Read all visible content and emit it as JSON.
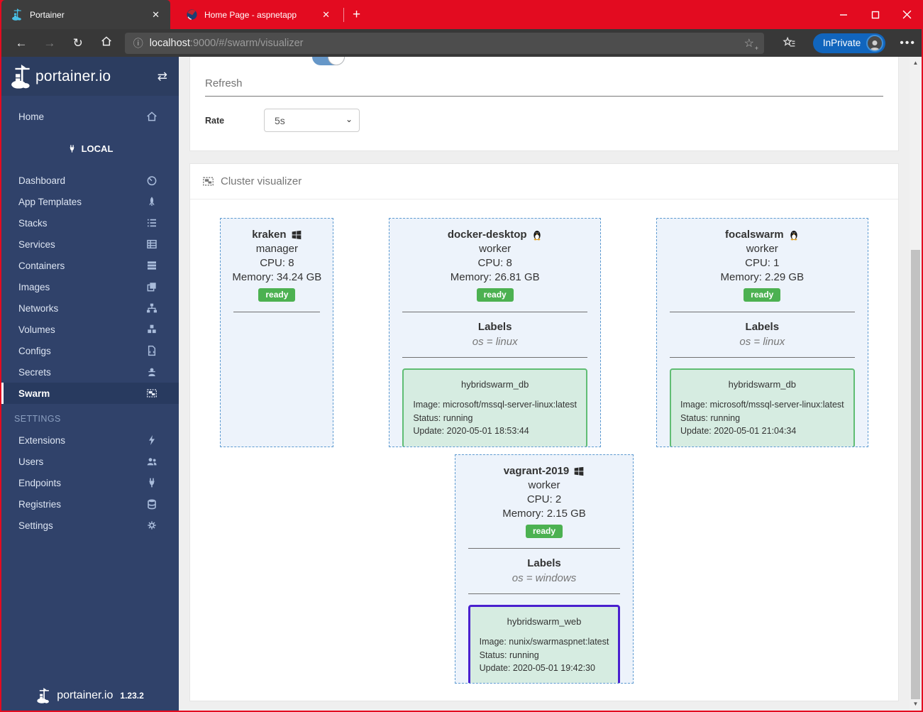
{
  "colors": {
    "frame_red": "#e30b20",
    "sidebar_blue": "#30426a",
    "ready_green": "#4cb151",
    "task_border_green": "#60bd74",
    "task_selected_purple": "#4a20cf",
    "node_border_blue": "#5e9bd1",
    "inprivate_blue": "#1165bd"
  },
  "browser": {
    "tabs": [
      {
        "title": "Portainer",
        "favicon": "portainer-whale-icon"
      },
      {
        "title": "Home Page - aspnetapp",
        "favicon": "aspnetcore-icon"
      }
    ],
    "address": {
      "host": "localhost",
      "path": ":9000/#/swarm/visualizer"
    },
    "inprivate_label": "InPrivate"
  },
  "sidebar": {
    "brand": "portainer.io",
    "home": {
      "label": "Home",
      "icon": "home-icon"
    },
    "endpoint_header": {
      "label": "LOCAL",
      "icon": "plug-icon"
    },
    "items": [
      {
        "label": "Dashboard",
        "icon": "tachometer-icon"
      },
      {
        "label": "App Templates",
        "icon": "rocket-icon"
      },
      {
        "label": "Stacks",
        "icon": "list-icon"
      },
      {
        "label": "Services",
        "icon": "th-list-icon"
      },
      {
        "label": "Containers",
        "icon": "server-icon"
      },
      {
        "label": "Images",
        "icon": "clone-icon"
      },
      {
        "label": "Networks",
        "icon": "sitemap-icon"
      },
      {
        "label": "Volumes",
        "icon": "cubes-icon"
      },
      {
        "label": "Configs",
        "icon": "file-icon"
      },
      {
        "label": "Secrets",
        "icon": "user-secret-icon"
      },
      {
        "label": "Swarm",
        "icon": "object-group-icon"
      }
    ],
    "settings_header": "SETTINGS",
    "settings_items": [
      {
        "label": "Extensions",
        "icon": "bolt-icon"
      },
      {
        "label": "Users",
        "icon": "users-icon"
      },
      {
        "label": "Endpoints",
        "icon": "plug-icon"
      },
      {
        "label": "Registries",
        "icon": "database-icon"
      },
      {
        "label": "Settings",
        "icon": "cogs-icon"
      }
    ],
    "footer": {
      "brand": "portainer.io",
      "version": "1.23.2"
    }
  },
  "main": {
    "refresh": {
      "title": "Refresh",
      "rate_label": "Rate",
      "rate_value": "5s"
    },
    "visualizer": {
      "title": "Cluster visualizer",
      "nodes": [
        {
          "name": "kraken",
          "os": "windows",
          "role": "manager",
          "cpu": "CPU: 8",
          "memory": "Memory: 34.24 GB",
          "status": "ready"
        },
        {
          "name": "docker-desktop",
          "os": "linux",
          "role": "worker",
          "cpu": "CPU: 8",
          "memory": "Memory: 26.81 GB",
          "status": "ready",
          "labels_title": "Labels",
          "labels": "os = linux",
          "task": {
            "name": "hybridswarm_db",
            "image": "Image: microsoft/mssql-server-linux:latest",
            "status": "Status: running",
            "update": "Update: 2020-05-01 18:53:44"
          }
        },
        {
          "name": "focalswarm",
          "os": "linux",
          "role": "worker",
          "cpu": "CPU: 1",
          "memory": "Memory: 2.29 GB",
          "status": "ready",
          "labels_title": "Labels",
          "labels": "os = linux",
          "task": {
            "name": "hybridswarm_db",
            "image": "Image: microsoft/mssql-server-linux:latest",
            "status": "Status: running",
            "update": "Update: 2020-05-01 21:04:34"
          }
        },
        {
          "name": "vagrant-2019",
          "os": "windows",
          "role": "worker",
          "cpu": "CPU: 2",
          "memory": "Memory: 2.15 GB",
          "status": "ready",
          "labels_title": "Labels",
          "labels": "os = windows",
          "task": {
            "name": "hybridswarm_web",
            "image": "Image: nunix/swarmaspnet:latest",
            "status": "Status: running",
            "update": "Update: 2020-05-01 19:42:30"
          }
        }
      ]
    }
  }
}
